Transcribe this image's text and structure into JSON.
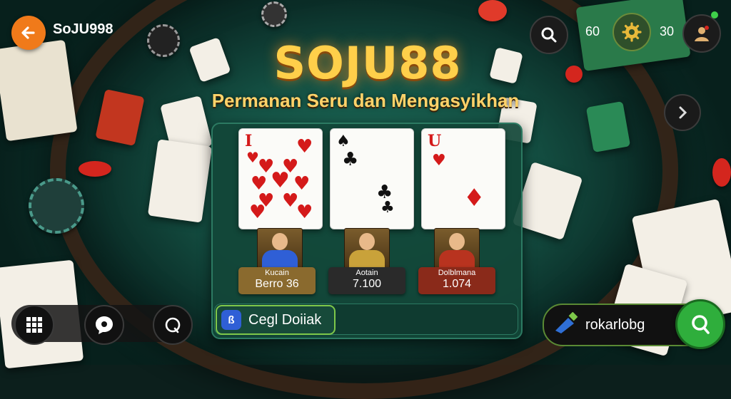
{
  "header": {
    "site_name": "SoJU998",
    "stat_left": "60",
    "stat_right": "30"
  },
  "logo": {
    "title": "SOJU88",
    "tagline": "Permanan Seru dan Mengasyikhan"
  },
  "table": {
    "cards": [
      {
        "corner": "I",
        "suit": "heart",
        "color": "red"
      },
      {
        "corner": "♠",
        "suit": "club",
        "color": "black"
      },
      {
        "corner": "U",
        "suit": "diamond",
        "color": "red"
      }
    ],
    "players": [
      {
        "name": "Kucain",
        "value": "Berro 36",
        "box_color": "#8a6a2e"
      },
      {
        "name": "Aotain",
        "value": "7.100",
        "box_color": "#2a2a2a"
      },
      {
        "name": "Dolblmana",
        "value": "1.074",
        "box_color": "#8a2a1a"
      }
    ],
    "action_button": {
      "label": "Cegl Doiiak",
      "icon": "app-icon"
    }
  },
  "bottom_right": {
    "label": "rokarlobg",
    "icon": "search-icon"
  },
  "colors": {
    "accent_orange": "#f07a1a",
    "felt": "#145043",
    "go_green": "#2fae3c",
    "logo_gold": "#ffcf4a"
  }
}
